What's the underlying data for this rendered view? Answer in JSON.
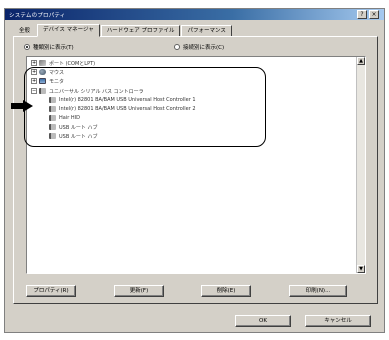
{
  "window": {
    "title": "システムのプロパティ",
    "help_label": "?",
    "close_label": "×"
  },
  "tabs": [
    {
      "label": "全般"
    },
    {
      "label": "デバイス マネージャ"
    },
    {
      "label": "ハードウェア プロファイル"
    },
    {
      "label": "パフォーマンス"
    }
  ],
  "view_options": {
    "by_type_label": "種類別に表示(T)",
    "by_connection_label": "接続別に表示(C)",
    "selected": "by_type"
  },
  "device_list": {
    "rows": [
      {
        "expander": "+",
        "icon": "port-icon",
        "label": "ポート (COMとLPT)"
      },
      {
        "expander": "+",
        "icon": "mouse-icon",
        "label": "マウス"
      },
      {
        "expander": "+",
        "icon": "monitor-icon",
        "label": "モニタ"
      },
      {
        "expander": "−",
        "icon": "usb-icon",
        "label": "ユニバーサル シリアル バス コントローラ"
      },
      {
        "expander": "",
        "icon": "usb-icon",
        "label": "Intel(r) 82801 BA/BAM USB Universal Host Controller 1"
      },
      {
        "expander": "",
        "icon": "usb-icon",
        "label": "Intel(r) 82801 BA/BAM USB Universal Host Controller 2"
      },
      {
        "expander": "",
        "icon": "usb-icon",
        "label": "Hair HID"
      },
      {
        "expander": "",
        "icon": "usb-icon",
        "label": "USB ルート ハブ"
      },
      {
        "expander": "",
        "icon": "usb-icon",
        "label": "USB ルート ハブ"
      }
    ]
  },
  "panel_buttons": {
    "properties_label": "プロパティ(R)",
    "refresh_label": "更新(F)",
    "remove_label": "削除(E)",
    "print_label": "印刷(N)..."
  },
  "dialog_buttons": {
    "ok_label": "OK",
    "cancel_label": "キャンセル"
  },
  "colors": {
    "title_bar": "#0a246a",
    "dialog_face": "#d4d0c8",
    "annotation": "#000000"
  }
}
